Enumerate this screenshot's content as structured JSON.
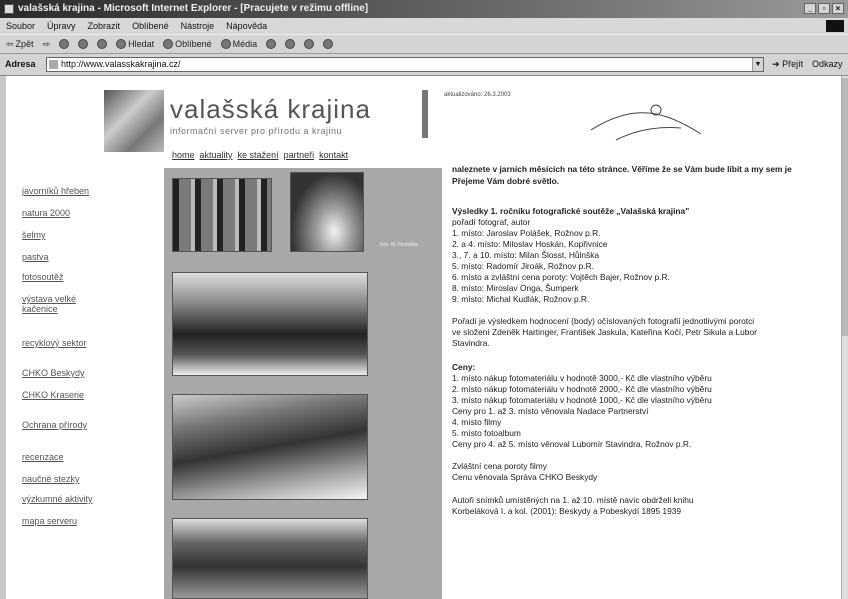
{
  "window": {
    "title": "valašská krajina - Microsoft Internet Explorer - [Pracujete v režimu offline]",
    "controls": [
      "_",
      "▫",
      "×"
    ]
  },
  "menu": [
    "Soubor",
    "Úpravy",
    "Zobrazit",
    "Oblíbené",
    "Nástroje",
    "Nápověda"
  ],
  "toolbar": {
    "back": "Zpět",
    "search": "Hledat",
    "favorites": "Oblíbené",
    "media": "Média"
  },
  "address": {
    "label": "Adresa",
    "url": "http://www.valasskakrajina.cz/",
    "go": "Přejít",
    "links": "Odkazy"
  },
  "site": {
    "logo_title": "valašská krajina",
    "logo_subtitle": "informační server pro přírodu a krajinu",
    "date": "aktualizováno: 26.3.2003",
    "nav": [
      "home",
      "aktuality",
      "ke stažení",
      "partneři",
      "kontakt"
    ]
  },
  "left_nav": [
    "javorníků hřeben",
    "natura 2000",
    "šelmy",
    "pastva",
    "fotosoutěž",
    "výstava velké kačenice",
    "recyklový sektor",
    "CHKO Beskydy",
    "CHKO Kraserie",
    "Ochrana přírody",
    "recenzace",
    "naučné stezky",
    "výzkumné aktivity",
    "mapa serveru"
  ],
  "photo_caption": "foto: M. Hrubiška",
  "content": {
    "intro_1": "naleznete v jarních měsících na této stránce. Věříme že se Vám bude líbit a my sem je",
    "intro_2": "Přejeme Vám dobré světlo.",
    "results_title": "Výsledky 1. ročníku fotografické soutěže „Valašská krajina\"",
    "results_sub": "pořadí fotograf, autor",
    "results": [
      "1. místo: Jaroslav Polášek, Rožnov p.R.",
      "2. a 4. místo: Miloslav Hoskán, Kopřivnice",
      "3., 7. a 10. místo: Milan Šlosst, Hůlnška",
      "5. místo: Radomír Jiroák, Rožnov p.R.",
      "6. místo a zvláštní cena poroty: Vojtěch Bajer, Rožnov p.R.",
      "8. místo: Miroslav Onga, Šumperk",
      "9. místo: Michal Kudlák, Rožnov p.R."
    ],
    "jury_1": "Pořadí je výsledkem hodnocení (body) očíslovaných fotografií jednotlivými porotci",
    "jury_2": "ve složení Zdeněk Hartinger, František Jaskula, Kateřina Kočí, Petr Sikula a Lubor",
    "jury_3": "Stavindra.",
    "prizes_title": "Ceny:",
    "prizes": [
      "1. místo nákup fotomateriálu v hodnotě 3000,- Kč dle vlastního výběru",
      "2. místo nákup fotomateriálu v hodnotě 2000,- Kč dle vlastního výběru",
      "3. místo nákup fotomateriálu v hodnotě 1000,- Kč dle vlastního výběru",
      "Ceny pro 1. až 3. místo věnovala Nadace Partnerství",
      "4. místo filmy",
      "5. místo fotoalbum",
      "Ceny pro 4. až 5. místo věnoval Lubomír Stavindra, Rožnov p.R."
    ],
    "special_1": "Zvláštní cena poroty filmy",
    "special_2": "Cenu věnovala Správa CHKO Beskydy",
    "footer_1": "Autoři snímků umístěných na 1. až 10. místě navíc obdrželi knihu",
    "footer_2": "Korbeláková I. a kol. (2001): Beskydy a Pobeskydí 1895 1939"
  }
}
